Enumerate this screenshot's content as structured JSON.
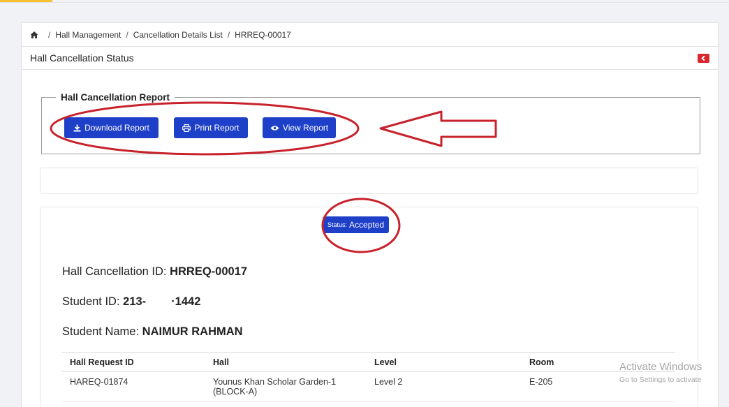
{
  "breadcrumb": {
    "items": [
      "Hall Management",
      "Cancellation Details List",
      "HRREQ-00017"
    ]
  },
  "page_title": "Hall Cancellation Status",
  "report": {
    "legend": "Hall Cancellation Report",
    "download_label": "Download Report",
    "print_label": "Print Report",
    "view_label": "View Report"
  },
  "status": {
    "label": "Status:",
    "value": "Accepted"
  },
  "details": {
    "cancellation_id_label": "Hall Cancellation ID:",
    "cancellation_id": "HRREQ-00017",
    "student_id_label": "Student ID:",
    "student_id_prefix": "213-",
    "student_id_suffix": "·1442",
    "student_name_label": "Student Name:",
    "student_name": "NAIMUR RAHMAN"
  },
  "table": {
    "headers": [
      "Hall Request ID",
      "Hall",
      "Level",
      "Room"
    ],
    "rows": [
      [
        "HAREQ-01874",
        "Younus Khan Scholar Garden-1 (BLOCK-A)",
        "Level 2",
        "E-205"
      ]
    ]
  },
  "watermark": {
    "line1": "Activate Windows",
    "line2": "Go to Settings to activate"
  },
  "colors": {
    "button_blue": "#1e40c8",
    "back_red": "#d9262f",
    "annotation_red": "#c8232c"
  },
  "icons": {
    "home": "home-icon",
    "back": "arrow-left-icon",
    "download": "download-icon",
    "print": "print-icon",
    "view": "eye-icon"
  }
}
